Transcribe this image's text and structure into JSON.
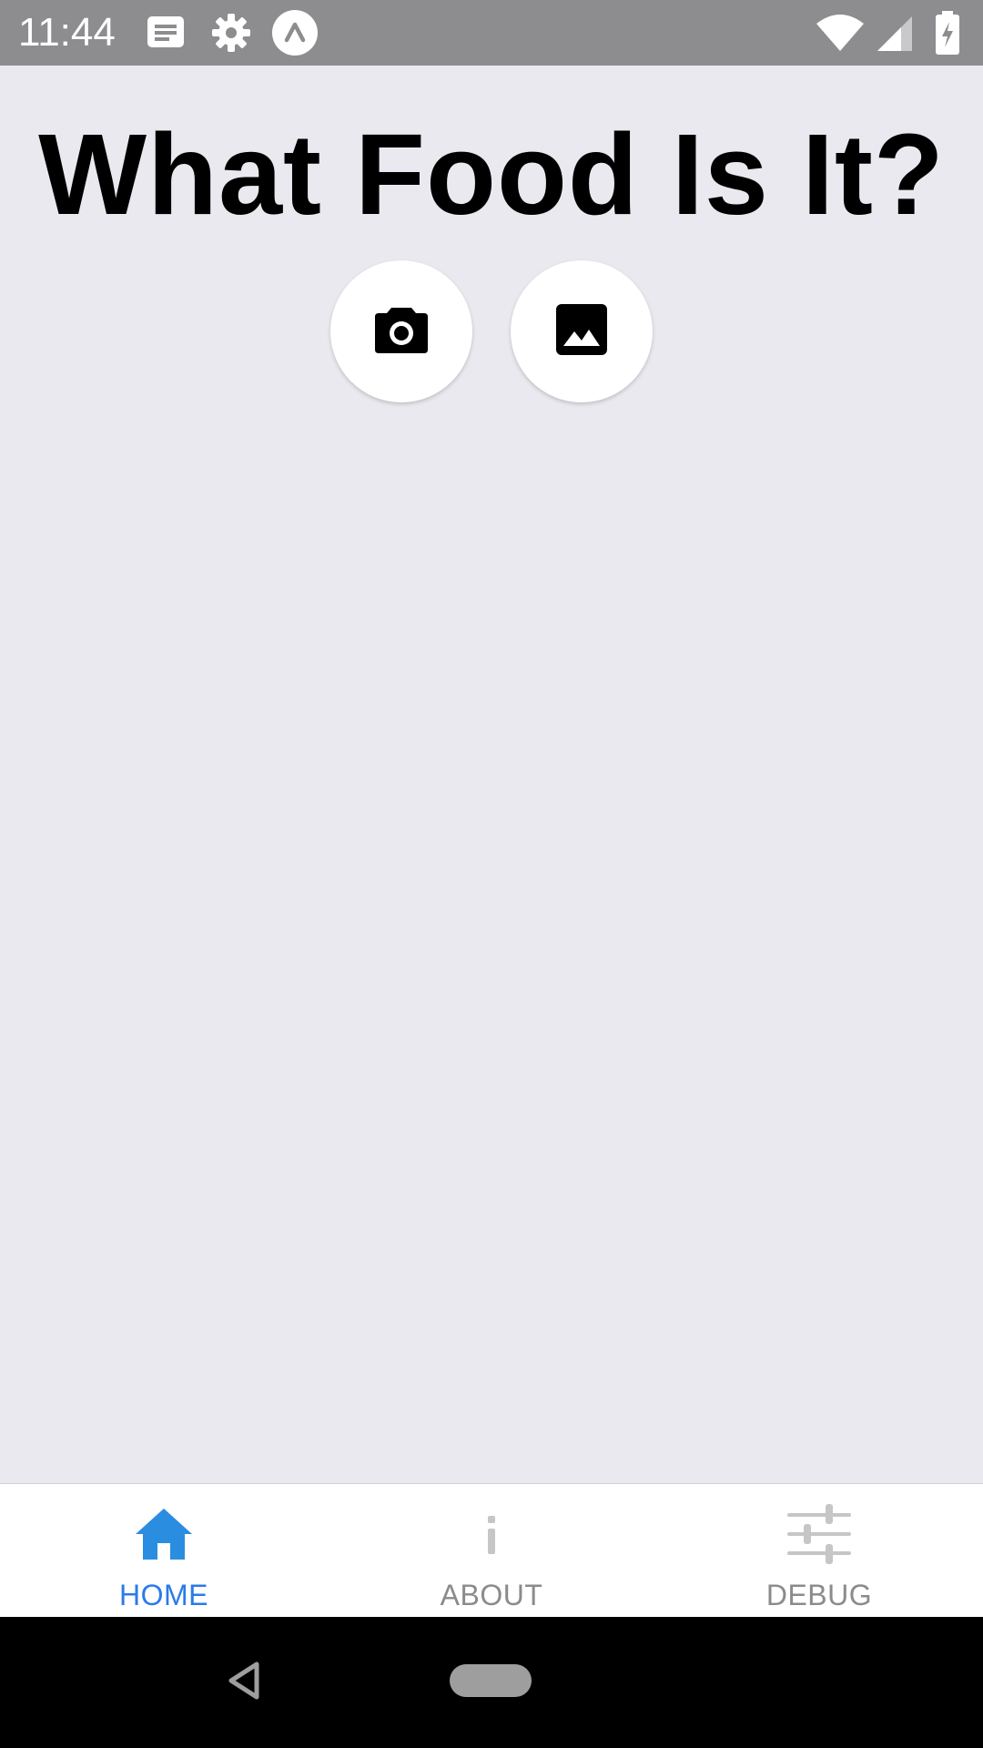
{
  "status_bar": {
    "time": "11:44",
    "icons": [
      "message-icon",
      "gear-icon",
      "expo-icon",
      "wifi-icon",
      "signal-icon",
      "battery-icon"
    ]
  },
  "main": {
    "title": "What Food Is It?",
    "buttons": [
      {
        "icon": "camera-icon"
      },
      {
        "icon": "image-icon"
      }
    ]
  },
  "tab_bar": {
    "active_color": "#2a7be8",
    "inactive_color": "#8b8b8b",
    "tabs": [
      {
        "label": "HOME",
        "icon": "home-icon",
        "active": true
      },
      {
        "label": "ABOUT",
        "icon": "info-icon",
        "active": false
      },
      {
        "label": "DEBUG",
        "icon": "sliders-icon",
        "active": false
      }
    ]
  },
  "nav_bar": {
    "icons": [
      "back-icon",
      "home-pill-icon"
    ]
  }
}
